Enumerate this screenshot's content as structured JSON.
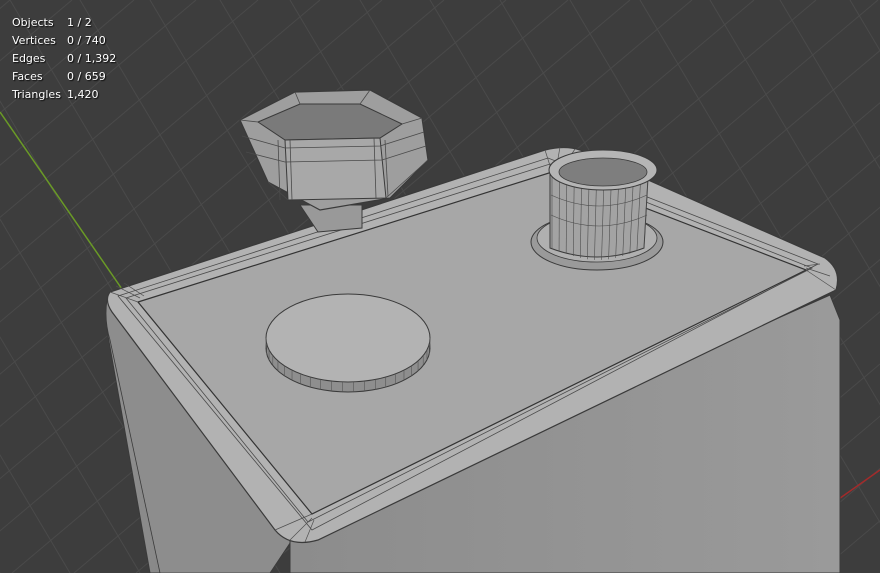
{
  "viewport": {
    "background_color": "#3d3d3d",
    "grid_line_color": "#4a4a4a",
    "axis_y_color": "#6a9a26",
    "axis_x_color": "#a42a2a",
    "mesh_face_color": "#a9a9a9",
    "mesh_dark_face_color": "#8a8a8a",
    "mesh_edge_color": "#3a3a3a"
  },
  "stats": [
    {
      "label": "Objects",
      "value": "1 / 2"
    },
    {
      "label": "Vertices",
      "value": "0 / 740"
    },
    {
      "label": "Edges",
      "value": "0 / 1,392"
    },
    {
      "label": "Faces",
      "value": "0 / 659"
    },
    {
      "label": "Triangles",
      "value": "1,420"
    }
  ]
}
